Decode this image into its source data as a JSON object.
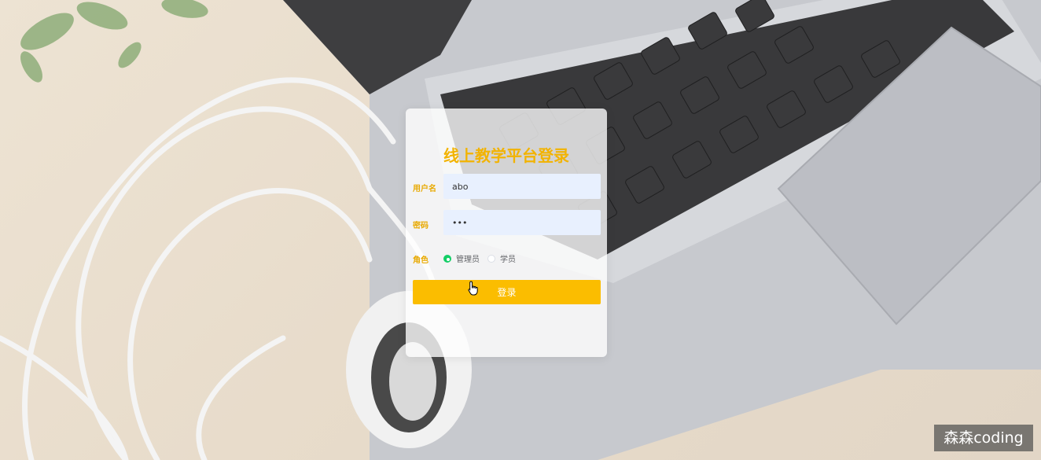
{
  "login": {
    "title": "线上教学平台登录",
    "username_label": "用户名",
    "username_value": "abo",
    "password_label": "密码",
    "password_value": "•••",
    "role_label": "角色",
    "roles": [
      {
        "label": "管理员",
        "checked": true
      },
      {
        "label": "学员",
        "checked": false
      }
    ],
    "submit_label": "登录"
  },
  "watermark": "森森coding",
  "colors": {
    "accent": "#fbbd00",
    "title": "#f2b300",
    "radio_checked": "#13ce66"
  }
}
